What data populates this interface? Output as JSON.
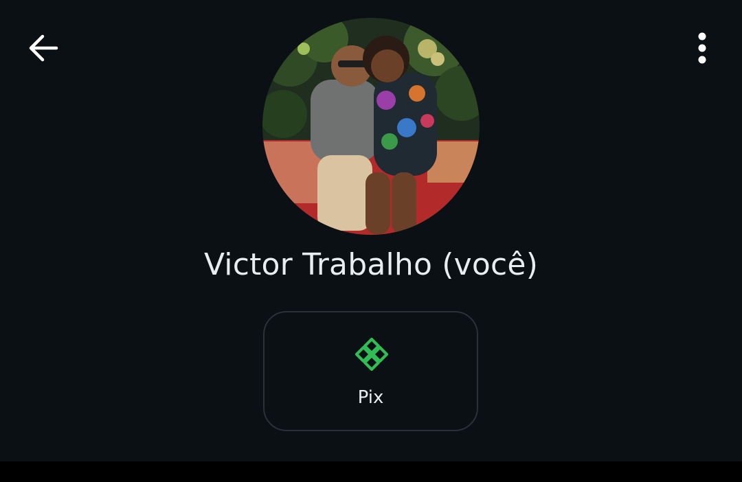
{
  "header": {
    "back_icon": "arrow-left-icon",
    "menu_icon": "more-vertical-icon"
  },
  "profile": {
    "avatar_icon": "profile-photo",
    "name": "Victor Trabalho (você)"
  },
  "payment": {
    "pix_label": "Pix",
    "pix_icon": "pix-icon",
    "accent": "#32bc56"
  },
  "colors": {
    "background": "#0b1014",
    "text": "#e9edef",
    "card_border": "#2a3238"
  }
}
